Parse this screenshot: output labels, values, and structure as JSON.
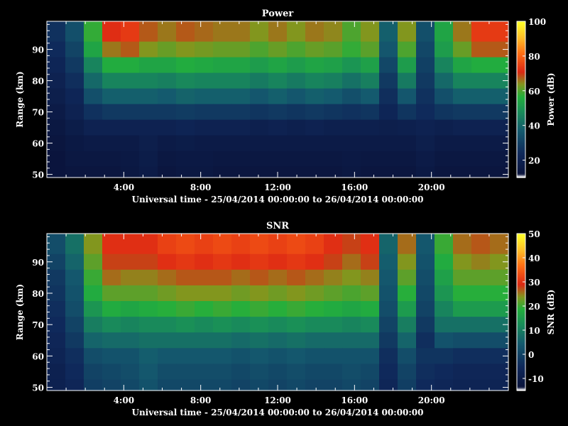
{
  "chart_data": [
    {
      "type": "heatmap",
      "title": "Power",
      "xlabel": "Universal time - 25/04/2014 00:00:00 to 26/04/2014 00:00:00",
      "ylabel": "Range (km)",
      "x_ticks": [
        "4:00",
        "8:00",
        "12:00",
        "16:00",
        "20:00"
      ],
      "y_ticks": [
        50,
        60,
        70,
        80,
        90
      ],
      "xlim_hours": [
        0,
        24
      ],
      "ylim_km": [
        49,
        99
      ],
      "colorbar": {
        "label": "Power (dB)",
        "ticks": [
          20,
          40,
          60,
          80,
          100
        ],
        "range": [
          10,
          100
        ]
      },
      "rows": [
        {
          "range_km": 95,
          "values": [
            26,
            34,
            58,
            72,
            74,
            68,
            66,
            68,
            67,
            66,
            66,
            64,
            66,
            64,
            66,
            65,
            60,
            64,
            38,
            64,
            34,
            54,
            66,
            74,
            74
          ]
        },
        {
          "range_km": 90,
          "values": [
            24,
            31,
            54,
            66,
            68,
            64,
            62,
            64,
            63,
            62,
            62,
            60,
            62,
            60,
            62,
            61,
            58,
            61,
            36,
            60,
            32,
            52,
            62,
            68,
            68
          ]
        },
        {
          "range_km": 85,
          "values": [
            22,
            28,
            46,
            56,
            56,
            54,
            54,
            56,
            55,
            54,
            54,
            52,
            54,
            52,
            54,
            53,
            50,
            53,
            32,
            52,
            30,
            46,
            54,
            56,
            56
          ]
        },
        {
          "range_km": 80,
          "values": [
            20,
            25,
            40,
            46,
            46,
            46,
            45,
            47,
            46,
            46,
            46,
            44,
            46,
            44,
            46,
            45,
            42,
            45,
            28,
            44,
            28,
            40,
            46,
            46,
            46
          ]
        },
        {
          "range_km": 75,
          "values": [
            18,
            22,
            34,
            38,
            38,
            38,
            37,
            39,
            38,
            38,
            38,
            36,
            38,
            36,
            38,
            37,
            34,
            37,
            25,
            36,
            26,
            34,
            38,
            38,
            38
          ]
        },
        {
          "range_km": 70,
          "values": [
            16,
            20,
            26,
            28,
            28,
            28,
            28,
            29,
            28,
            28,
            28,
            27,
            28,
            27,
            28,
            27,
            26,
            27,
            22,
            27,
            24,
            27,
            28,
            28,
            28
          ]
        },
        {
          "range_km": 65,
          "values": [
            14,
            17,
            20,
            20,
            20,
            20,
            20,
            21,
            20,
            20,
            20,
            19,
            20,
            19,
            20,
            19,
            19,
            19,
            18,
            19,
            20,
            19,
            20,
            20,
            20
          ]
        },
        {
          "range_km": 60,
          "values": [
            13,
            15,
            16,
            16,
            16,
            18,
            16,
            17,
            16,
            16,
            16,
            16,
            16,
            16,
            16,
            16,
            16,
            16,
            16,
            16,
            18,
            16,
            16,
            16,
            16
          ]
        },
        {
          "range_km": 55,
          "values": [
            12,
            14,
            14,
            14,
            15,
            17,
            14,
            15,
            15,
            14,
            14,
            14,
            14,
            14,
            14,
            14,
            15,
            14,
            14,
            14,
            16,
            14,
            14,
            14,
            14
          ]
        },
        {
          "range_km": 50,
          "values": [
            12,
            13,
            13,
            13,
            14,
            16,
            13,
            14,
            14,
            13,
            13,
            13,
            13,
            13,
            13,
            13,
            14,
            13,
            13,
            13,
            15,
            13,
            13,
            13,
            13
          ]
        }
      ]
    },
    {
      "type": "heatmap",
      "title": "SNR",
      "xlabel": "Universal time - 25/04/2014 00:00:00 to 26/04/2014 00:00:00",
      "ylabel": "Range (km)",
      "x_ticks": [
        "4:00",
        "8:00",
        "12:00",
        "16:00",
        "20:00"
      ],
      "y_ticks": [
        50,
        60,
        70,
        80,
        90
      ],
      "xlim_hours": [
        0,
        24
      ],
      "ylim_km": [
        49,
        99
      ],
      "colorbar": {
        "label": "SNR (dB)",
        "ticks": [
          -10,
          0,
          10,
          20,
          30,
          40,
          50
        ],
        "range": [
          -15,
          50
        ]
      },
      "rows": [
        {
          "range_km": 95,
          "values": [
            2,
            8,
            24,
            30,
            30,
            30,
            32,
            33,
            32,
            33,
            32,
            33,
            32,
            33,
            32,
            30,
            28,
            30,
            6,
            26,
            4,
            20,
            26,
            27,
            26
          ]
        },
        {
          "range_km": 90,
          "values": [
            0,
            6,
            22,
            28,
            28,
            28,
            30,
            31,
            30,
            31,
            30,
            31,
            30,
            31,
            30,
            28,
            26,
            28,
            5,
            24,
            3,
            18,
            24,
            25,
            24
          ]
        },
        {
          "range_km": 85,
          "values": [
            -2,
            4,
            20,
            26,
            25,
            25,
            26,
            27,
            27,
            27,
            26,
            27,
            26,
            27,
            26,
            25,
            24,
            25,
            4,
            22,
            2,
            16,
            22,
            22,
            22
          ]
        },
        {
          "range_km": 80,
          "values": [
            -3,
            3,
            18,
            22,
            22,
            22,
            23,
            24,
            24,
            24,
            23,
            24,
            23,
            24,
            23,
            22,
            21,
            22,
            3,
            19,
            1,
            14,
            19,
            19,
            19
          ]
        },
        {
          "range_km": 75,
          "values": [
            -4,
            2,
            14,
            18,
            17,
            18,
            19,
            20,
            19,
            20,
            19,
            20,
            19,
            20,
            19,
            18,
            17,
            18,
            2,
            15,
            0,
            11,
            15,
            15,
            15
          ]
        },
        {
          "range_km": 70,
          "values": [
            -5,
            0,
            10,
            12,
            11,
            12,
            12,
            13,
            12,
            13,
            12,
            13,
            12,
            13,
            12,
            12,
            11,
            12,
            0,
            10,
            -2,
            8,
            8,
            8,
            8
          ]
        },
        {
          "range_km": 65,
          "values": [
            -6,
            -2,
            6,
            7,
            7,
            8,
            8,
            8,
            8,
            8,
            7,
            8,
            7,
            8,
            7,
            7,
            7,
            7,
            -2,
            6,
            -4,
            3,
            2,
            2,
            2
          ]
        },
        {
          "range_km": 60,
          "values": [
            -7,
            -4,
            2,
            3,
            3,
            5,
            4,
            4,
            4,
            4,
            3,
            4,
            3,
            4,
            3,
            3,
            3,
            3,
            -4,
            2,
            -3,
            -3,
            -4,
            -4,
            -4
          ]
        },
        {
          "range_km": 55,
          "values": [
            -8,
            -5,
            0,
            1,
            2,
            4,
            2,
            2,
            2,
            2,
            1,
            2,
            1,
            2,
            1,
            1,
            2,
            1,
            -5,
            0,
            -4,
            -5,
            -6,
            -6,
            -6
          ]
        },
        {
          "range_km": 50,
          "values": [
            -8,
            -6,
            -1,
            0,
            1,
            3,
            1,
            1,
            1,
            1,
            0,
            1,
            0,
            1,
            0,
            0,
            1,
            0,
            -6,
            -1,
            -5,
            -6,
            -7,
            -7,
            -7
          ]
        }
      ]
    }
  ]
}
